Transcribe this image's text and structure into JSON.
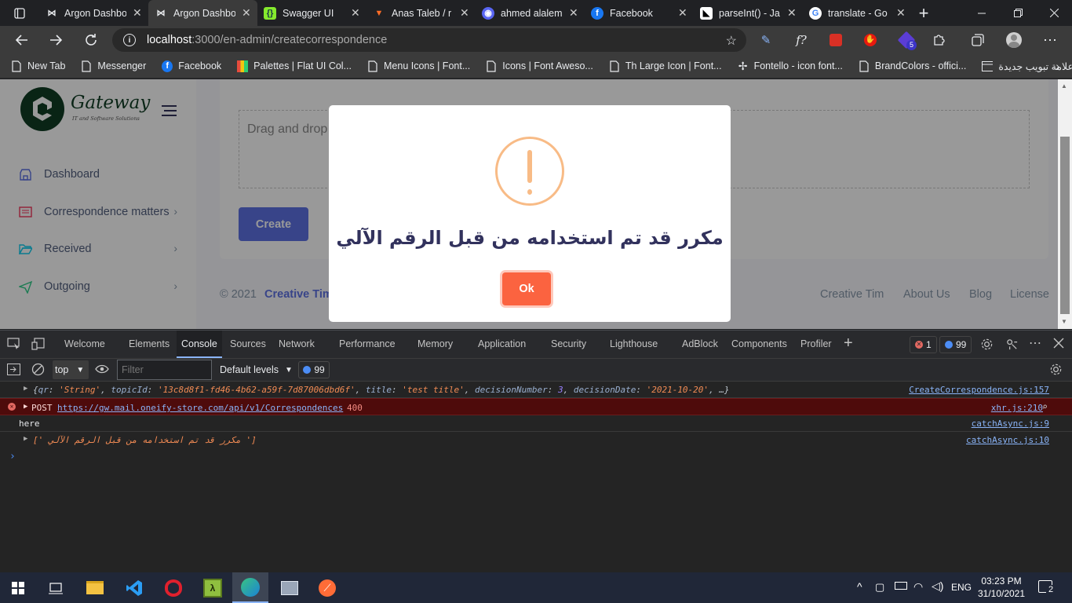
{
  "tabs": [
    {
      "title": "Argon Dashbo",
      "icon": "argon-icon",
      "active": false
    },
    {
      "title": "Argon Dashbo",
      "icon": "argon-icon",
      "active": true
    },
    {
      "title": "Swagger UI",
      "icon": "swagger-icon",
      "active": false
    },
    {
      "title": "Anas Taleb / r",
      "icon": "gitlab-icon",
      "active": false
    },
    {
      "title": "ahmed alalem",
      "icon": "discord-icon",
      "active": false
    },
    {
      "title": "Facebook",
      "icon": "facebook-icon",
      "active": false
    },
    {
      "title": "parseInt() - Ja",
      "icon": "mdn-icon",
      "active": false
    },
    {
      "title": "translate - Go",
      "icon": "google-icon",
      "active": false
    }
  ],
  "address": {
    "host": "localhost",
    "path": ":3000/en-admin/createcorrespondence"
  },
  "bookmarks": [
    {
      "label": "New Tab",
      "icon": "page-icon"
    },
    {
      "label": "Messenger",
      "icon": "page-icon"
    },
    {
      "label": "Facebook",
      "icon": "facebook-icon"
    },
    {
      "label": "Palettes | Flat UI Col...",
      "icon": "palette-icon"
    },
    {
      "label": "Menu Icons | Font...",
      "icon": "page-icon"
    },
    {
      "label": "Icons | Font Aweso...",
      "icon": "page-icon"
    },
    {
      "label": "Th Large Icon | Font...",
      "icon": "page-icon"
    },
    {
      "label": "Fontello - icon font...",
      "icon": "fontello-icon"
    },
    {
      "label": "BrandColors - offici...",
      "icon": "page-icon"
    },
    {
      "label": "علامة تبويب جديدة",
      "icon": "newtab-icon"
    }
  ],
  "extension_badge": "5",
  "sidebar": {
    "brand": "Gateway",
    "brand_sub": "IT and Software Solutions",
    "items": [
      {
        "label": "Dashboard",
        "icon": "shop-icon"
      },
      {
        "label": "Correspondence matters",
        "icon": "card-icon"
      },
      {
        "label": "Received",
        "icon": "folder-open-icon"
      },
      {
        "label": "Outgoing",
        "icon": "send-icon"
      }
    ]
  },
  "main": {
    "dropzone_text": "Drag and drop",
    "create_button": "Create",
    "footer_copy": "© 2021",
    "footer_brand": "Creative Tim",
    "footer_links": [
      "Creative Tim",
      "About Us",
      "Blog",
      "License"
    ]
  },
  "modal": {
    "message": "مكرر قد تم استخدامه من قبل الرقم الآلي",
    "ok": "Ok",
    "icon": "warning-icon"
  },
  "devtools": {
    "tabs": [
      "Welcome",
      "Elements",
      "Console",
      "Sources",
      "Network",
      "Performance",
      "Memory",
      "Application",
      "Security",
      "Lighthouse",
      "AdBlock",
      "Components",
      "Profiler"
    ],
    "active_tab": "Console",
    "error_count": "1",
    "message_count": "99",
    "context": "top",
    "filter_placeholder": "Filter",
    "levels": "Default levels",
    "issues_count": "99",
    "logs": {
      "obj_open": "{",
      "obj_k1": "qr",
      "obj_v1": "'String'",
      "obj_k2": "topicId",
      "obj_v2": "'13c8d8f1-fd46-4b62-a59f-7d87006dbd6f'",
      "obj_k3": "title",
      "obj_v3": "'test title'",
      "obj_k4": "decisionNumber",
      "obj_v4": "3",
      "obj_k5": "decisionDate",
      "obj_v5": "'2021-10-20'",
      "obj_tail": "…}",
      "src1": "CreateCorrespondence.js:157",
      "err_method": "POST",
      "err_url": "https://gw.mail.oneify-store.com/api/v1/Correspondences",
      "err_code": "400",
      "src2": "xhr.js:210",
      "here": "here",
      "src3": "catchAsync.js:9",
      "arr_text": "[' مكرر قد تم استخدامه من قبل الرقم الآلي ']",
      "src4": "catchAsync.js:10"
    }
  },
  "taskbar": {
    "lang": "ENG",
    "time": "03:23 PM",
    "date": "31/10/2021",
    "notif_count": "2"
  },
  "colors": {
    "primary": "#5e72e4",
    "ok_button": "#fb6340",
    "warning": "#f8bb86",
    "modal_text": "#32325d"
  }
}
